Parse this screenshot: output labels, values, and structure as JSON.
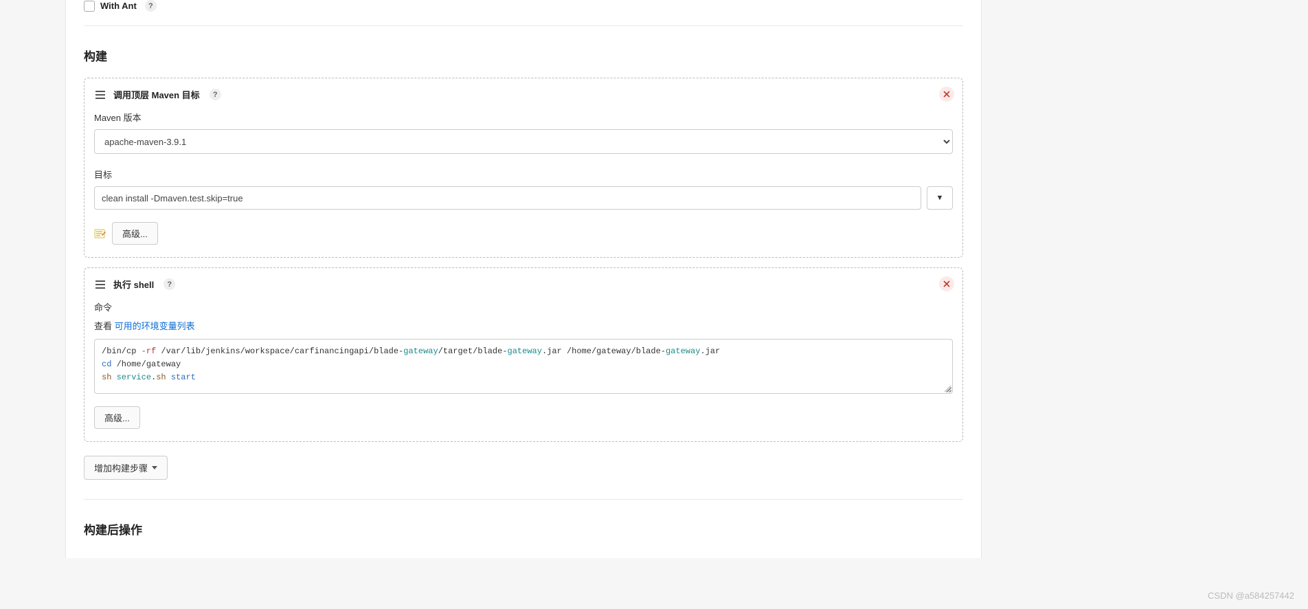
{
  "top": {
    "with_ant_label": "With Ant"
  },
  "sections": {
    "build_title": "构建",
    "post_build_title": "构建后操作"
  },
  "maven": {
    "card_title": "调用顶层 Maven 目标",
    "version_label": "Maven 版本",
    "version_value": "apache-maven-3.9.1",
    "goal_label": "目标",
    "goal_value": "clean install -Dmaven.test.skip=true",
    "advanced_label": "高级..."
  },
  "shell": {
    "card_title": "执行 shell",
    "command_label": "命令",
    "hint_prefix": "查看 ",
    "hint_link": "可用的环境变量列表",
    "advanced_label": "高级...",
    "code": {
      "line1_pre": "/bin/cp ",
      "line1_flag": "-rf",
      "line1_mid1": " /var/lib/jenkins/workspace/carfinancingapi/blade-",
      "gateway": "gateway",
      "line1_mid2": "/target/blade-",
      "line1_mid3": ".jar /home/gateway/blade-",
      "line1_end": ".jar",
      "line2_cd": "cd",
      "line2_path": " /home/gateway",
      "line3_sh": "sh",
      "line3_sp": " ",
      "line3_service": "service",
      "line3_dot": ".",
      "line3_sh2": "sh",
      "line3_sp2": " ",
      "line3_start": "start"
    }
  },
  "add_step_label": "增加构建步骤",
  "watermark": "CSDN @a584257442"
}
